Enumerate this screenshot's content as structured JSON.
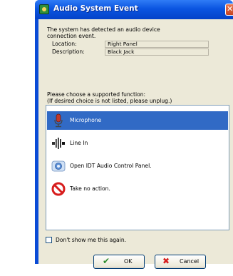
{
  "window": {
    "title": "Audio System Event"
  },
  "intro": {
    "line1": "The system has detected an audio device",
    "line2": "connection event."
  },
  "details": {
    "location_label": "Location:",
    "location_value": "Right Panel",
    "description_label": "Description:",
    "description_value": "Black Jack"
  },
  "prompt": {
    "line1": "Please choose a supported function:",
    "line2": "(If desired choice is not listed, please unplug.)"
  },
  "options": [
    {
      "label": "Microphone",
      "icon": "microphone-icon",
      "selected": true
    },
    {
      "label": "Line In",
      "icon": "line-in-icon",
      "selected": false
    },
    {
      "label": "Open IDT Audio Control Panel.",
      "icon": "control-panel-icon",
      "selected": false
    },
    {
      "label": "Take no action.",
      "icon": "no-action-icon",
      "selected": false
    }
  ],
  "dont_show": {
    "label": "Don't show me this again.",
    "checked": false
  },
  "buttons": {
    "ok": "OK",
    "cancel": "Cancel"
  },
  "colors": {
    "titlebar": "#0b55e1",
    "selection": "#316ac5",
    "dialog_bg": "#ece9d8"
  }
}
